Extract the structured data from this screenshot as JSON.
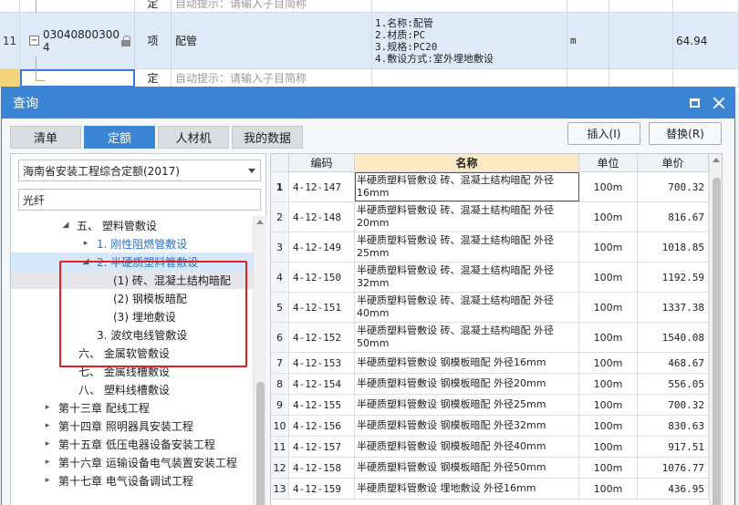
{
  "bg": {
    "row_prev": {
      "type": "定",
      "hint": "自动提示：请输入子目简称"
    },
    "row_main": {
      "index": "11",
      "collapse": "−",
      "code_line1": "03040800300",
      "code_line2": "4",
      "type": "项",
      "name": "配管",
      "features": [
        "1.名称:配管",
        "2.材质:PC",
        "3.规格:PC20",
        "4.敷设方式:室外埋地敷设"
      ],
      "unit": "m",
      "qty": "64.94"
    },
    "row_next": {
      "type": "定",
      "hint": "自动提示：请输入子目简称"
    }
  },
  "dialog": {
    "title": "查询",
    "tabs": [
      "清单",
      "定额",
      "人材机",
      "我的数据"
    ],
    "active_tab": 1,
    "insert_label": "插入(I)",
    "replace_label": "替换(R)",
    "library": "海南省安装工程综合定额(2017)",
    "search_value": "光纤",
    "tree": [
      {
        "tri": "◢",
        "label": "五、 塑料管敷设"
      },
      {
        "tri": "▸",
        "label": "1. 刚性阻燃管敷设"
      },
      {
        "tri": "◢",
        "label": "2. 半硬质塑料管敷设"
      },
      {
        "tri": "",
        "label": "(1) 砖、混凝土结构暗配"
      },
      {
        "tri": "",
        "label": "(2) 钢模板暗配"
      },
      {
        "tri": "",
        "label": "(3) 埋地敷设"
      },
      {
        "tri": "",
        "label": "3. 波纹电线管敷设"
      },
      {
        "tri": "",
        "label": "六、 金属软管敷设"
      },
      {
        "tri": "",
        "label": "七、 金属线槽敷设"
      },
      {
        "tri": "",
        "label": "八、 塑料线槽敷设"
      },
      {
        "tri": "▸",
        "label": "第十三章 配线工程"
      },
      {
        "tri": "▸",
        "label": "第十四章 照明器具安装工程"
      },
      {
        "tri": "▸",
        "label": "第十五章 低压电器设备安装工程"
      },
      {
        "tri": "▸",
        "label": "第十六章 运输设备电气装置安装工程"
      },
      {
        "tri": "▸",
        "label": "第十七章 电气设备调试工程"
      }
    ],
    "grid": {
      "headers": [
        "",
        "编码",
        "名称",
        "单位",
        "单价"
      ],
      "rows": [
        {
          "n": "1",
          "code": "4-12-147",
          "name": "半硬质塑料管敷设 砖、混凝土结构暗配 外径16mm",
          "unit": "100m",
          "price": "700.32"
        },
        {
          "n": "2",
          "code": "4-12-148",
          "name": "半硬质塑料管敷设 砖、混凝土结构暗配 外径20mm",
          "unit": "100m",
          "price": "816.67"
        },
        {
          "n": "3",
          "code": "4-12-149",
          "name": "半硬质塑料管敷设 砖、混凝土结构暗配 外径25mm",
          "unit": "100m",
          "price": "1018.85"
        },
        {
          "n": "4",
          "code": "4-12-150",
          "name": "半硬质塑料管敷设 砖、混凝土结构暗配 外径32mm",
          "unit": "100m",
          "price": "1192.59"
        },
        {
          "n": "5",
          "code": "4-12-151",
          "name": "半硬质塑料管敷设 砖、混凝土结构暗配 外径40mm",
          "unit": "100m",
          "price": "1337.38"
        },
        {
          "n": "6",
          "code": "4-12-152",
          "name": "半硬质塑料管敷设 砖、混凝土结构暗配 外径50mm",
          "unit": "100m",
          "price": "1540.08"
        },
        {
          "n": "7",
          "code": "4-12-153",
          "name": "半硬质塑料管敷设 钢模板暗配 外径16mm",
          "unit": "100m",
          "price": "468.67"
        },
        {
          "n": "8",
          "code": "4-12-154",
          "name": "半硬质塑料管敷设 钢模板暗配 外径20mm",
          "unit": "100m",
          "price": "556.05"
        },
        {
          "n": "9",
          "code": "4-12-155",
          "name": "半硬质塑料管敷设 钢模板暗配 外径25mm",
          "unit": "100m",
          "price": "700.32"
        },
        {
          "n": "10",
          "code": "4-12-156",
          "name": "半硬质塑料管敷设 钢模板暗配 外径32mm",
          "unit": "100m",
          "price": "830.63"
        },
        {
          "n": "11",
          "code": "4-12-157",
          "name": "半硬质塑料管敷设 钢模板暗配 外径40mm",
          "unit": "100m",
          "price": "917.51"
        },
        {
          "n": "12",
          "code": "4-12-158",
          "name": "半硬质塑料管敷设 钢模板暗配 外径50mm",
          "unit": "100m",
          "price": "1076.77"
        },
        {
          "n": "13",
          "code": "4-12-159",
          "name": "半硬质塑料管敷设 埋地敷设 外径16mm",
          "unit": "100m",
          "price": "436.95"
        }
      ]
    }
  }
}
